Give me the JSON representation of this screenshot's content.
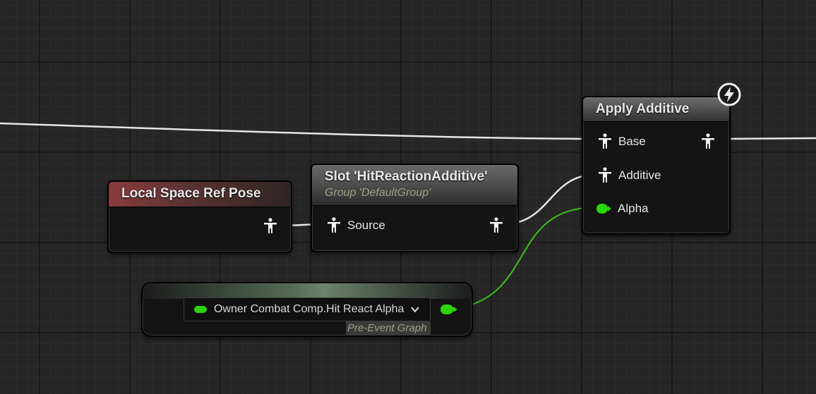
{
  "graph": {
    "nodes": {
      "local_space_ref_pose": {
        "title": "Local Space Ref Pose"
      },
      "slot": {
        "title": "Slot 'HitReactionAdditive'",
        "subtitle": "Group 'DefaultGroup'",
        "input_label": "Source"
      },
      "apply_additive": {
        "title": "Apply Additive",
        "pins": {
          "base": "Base",
          "additive": "Additive",
          "alpha": "Alpha"
        }
      },
      "variable": {
        "name": "Owner Combat Comp.Hit React Alpha",
        "tag": "Pre-Event Graph"
      }
    },
    "colors": {
      "pose_wire": "#e6e6e6",
      "float_pin": "#2cd40a",
      "ref_pose_header": "#8a3b3b"
    },
    "icons": [
      "pose-icon",
      "float-pin-icon",
      "chevron-down-icon",
      "fast-path-bolt-icon"
    ]
  }
}
